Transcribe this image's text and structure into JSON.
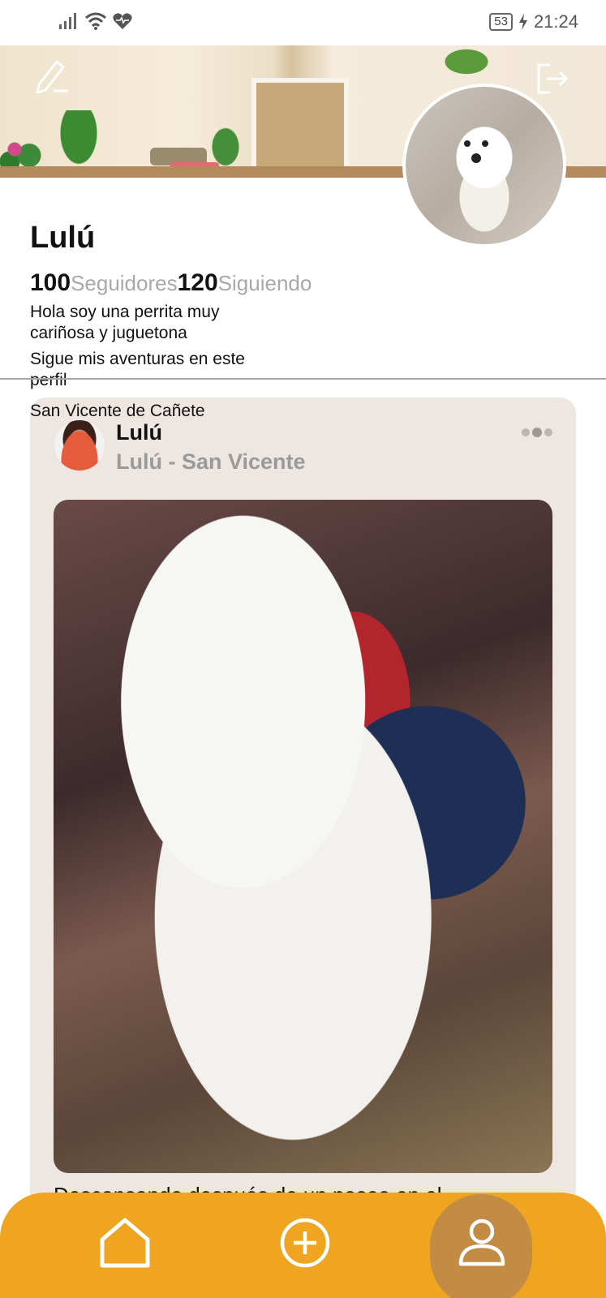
{
  "status_bar": {
    "battery_level": "53",
    "time": "21:24",
    "icons": [
      "signal-icon",
      "wifi-icon",
      "heart-monitor-icon",
      "battery-icon",
      "charging-icon"
    ]
  },
  "profile": {
    "name": "Lulú",
    "followers_count": "100",
    "followers_label": "Seguidores",
    "following_count": "120",
    "following_label": "Siguiendo",
    "bio_line1": "Hola soy una perrita muy cariñosa y juguetona",
    "bio_line2": "Sigue mis aventuras en este perfil",
    "location": "San Vicente de Cañete"
  },
  "post": {
    "author": "Lulú",
    "location": "Lulú - San Vicente",
    "caption": "Descansando después de un paseo en el"
  },
  "nav": {
    "items": [
      "home-icon",
      "add-icon",
      "profile-icon"
    ],
    "active": "profile"
  },
  "colors": {
    "accent": "#efa51f",
    "active_nav": "#c38c45",
    "card_bg": "#ede6e1",
    "muted_text": "#a8a8a8"
  }
}
